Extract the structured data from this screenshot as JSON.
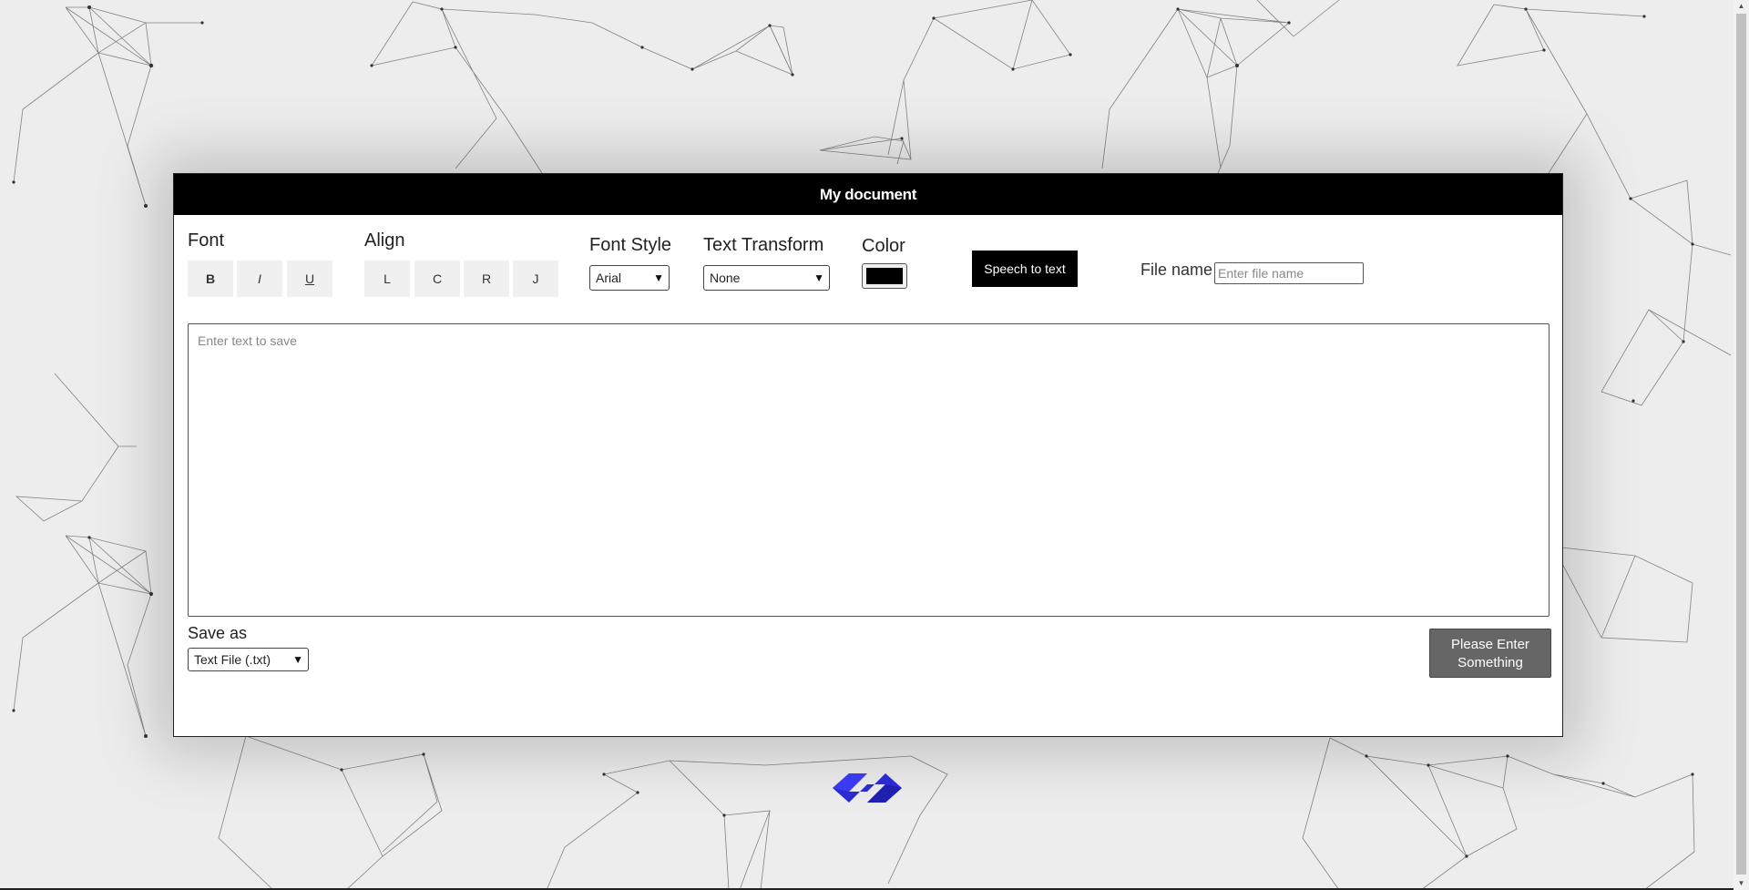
{
  "document": {
    "title": "My document"
  },
  "toolbar": {
    "font_label": "Font",
    "bold_label": "B",
    "italic_label": "I",
    "underline_label": "U",
    "align_label": "Align",
    "align_left_label": "L",
    "align_center_label": "C",
    "align_right_label": "R",
    "align_justify_label": "J",
    "font_style_label": "Font Style",
    "font_style_value": "Arial",
    "text_transform_label": "Text Transform",
    "text_transform_value": "None",
    "color_label": "Color",
    "color_value": "#000000",
    "speech_button_label": "Speech to text",
    "file_name_label": "File name",
    "file_name_placeholder": "Enter file name"
  },
  "editor": {
    "placeholder": "Enter text to save"
  },
  "footer": {
    "save_as_label": "Save as",
    "save_as_value": "Text File (.txt)",
    "submit_line1": "Please Enter",
    "submit_line2": "Something"
  },
  "colors": {
    "header_bg": "#000000",
    "submit_bg": "#666666",
    "logo": "#2b2bd4"
  },
  "icons": {
    "select_arrow": "chevron-down-icon",
    "logo": "s-logo-icon"
  }
}
